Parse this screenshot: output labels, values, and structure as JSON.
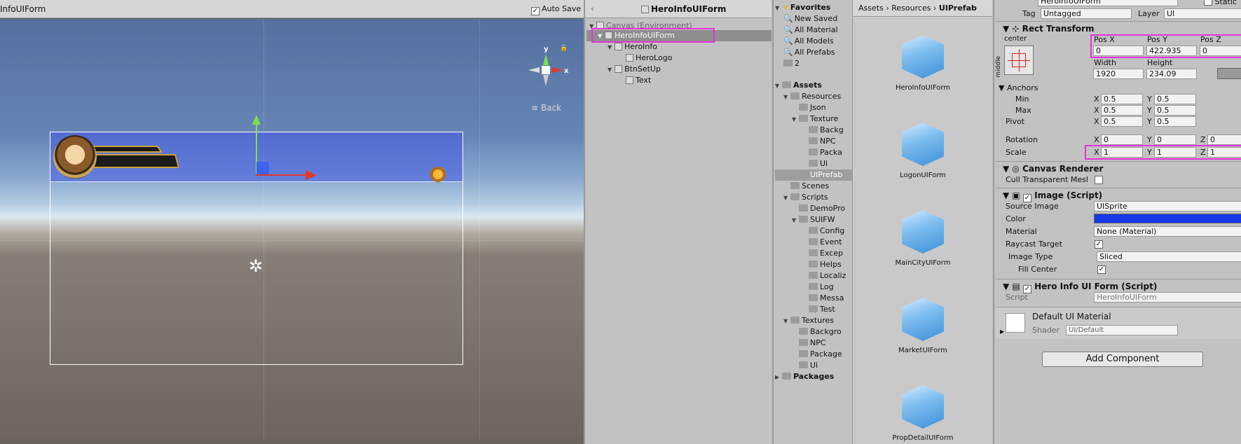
{
  "scene": {
    "title": "InfoUIForm",
    "auto_save_label": "Auto Save",
    "back_label": "≡ Back",
    "gizmo_y_label": "y",
    "gizmo_x_label": "x"
  },
  "hierarchy": {
    "title": "HeroInfoUIForm",
    "items": [
      {
        "label": "Canvas (Environment)"
      },
      {
        "label": "HeroInfoUIForm"
      },
      {
        "label": "HeroInfo"
      },
      {
        "label": "HeroLogo"
      },
      {
        "label": "BtnSetUp"
      },
      {
        "label": "Text"
      }
    ]
  },
  "project": {
    "favorites_label": "Favorites",
    "favorites": [
      "New Saved",
      "All Material",
      "All Models",
      "All Prefabs",
      "2"
    ],
    "assets_label": "Assets",
    "tree": [
      "Resources",
      "Json",
      "Texture",
      "Backg",
      "NPC",
      "Packa",
      "Ui",
      "UIPrefab",
      "Scenes",
      "Scripts",
      "DemoPro",
      "SUIFW",
      "Config",
      "Event",
      "Excep",
      "Helps",
      "Localiz",
      "Log",
      "Messa",
      "Test",
      "Textures",
      "Backgro",
      "NPC",
      "Package",
      "Ui"
    ],
    "packages_label": "Packages"
  },
  "files": {
    "breadcrumb": [
      "Assets",
      "Resources",
      "UIPrefab"
    ],
    "items": [
      "HeroInfoUIForm",
      "LogonUIForm",
      "MainCityUIForm",
      "MarketUIForm",
      "PropDetailUIForm"
    ]
  },
  "inspector": {
    "object_name": "HeroInfoUIForm",
    "static_label": "Static",
    "tag_label": "Tag",
    "tag_value": "Untagged",
    "layer_label": "Layer",
    "layer_value": "UI",
    "rect_transform_label": "Rect Transform",
    "anchor_preset_h": "center",
    "anchor_preset_v": "middle",
    "pos_x_label": "Pos X",
    "pos_x": "0",
    "pos_y_label": "Pos Y",
    "pos_y": "422.935",
    "pos_z_label": "Pos Z",
    "pos_z": "0",
    "width_label": "Width",
    "width": "1920",
    "height_label": "Height",
    "height": "234.09",
    "anchors_label": "Anchors",
    "min_label": "Min",
    "min_x": "0.5",
    "min_y": "0.5",
    "max_label": "Max",
    "max_x": "0.5",
    "max_y": "0.5",
    "pivot_label": "Pivot",
    "pivot_x": "0.5",
    "pivot_y": "0.5",
    "rotation_label": "Rotation",
    "rot_x": "0",
    "rot_y": "0",
    "rot_z": "0",
    "scale_label": "Scale",
    "scale_x": "1",
    "scale_y": "1",
    "scale_z": "1",
    "axis_x": "X",
    "axis_y": "Y",
    "axis_z": "Z",
    "canvas_renderer_label": "Canvas Renderer",
    "cull_label": "Cull Transparent Mesl",
    "image_script_label": "Image (Script)",
    "source_image_label": "Source Image",
    "source_image": "UISprite",
    "color_label": "Color",
    "material_label": "Material",
    "material": "None (Material)",
    "raycast_label": "Raycast Target",
    "image_type_label": "Image Type",
    "image_type": "Sliced",
    "fill_center_label": "Fill Center",
    "hero_script_label": "Hero Info UI Form (Script)",
    "script_label": "Script",
    "script_value": "HeroInfoUIForm",
    "default_material_label": "Default UI Material",
    "shader_label": "Shader",
    "shader_value": "UI/Default",
    "add_component_label": "Add Component",
    "color_value": "#1638e6",
    "highlight_color": "#e433d8"
  }
}
